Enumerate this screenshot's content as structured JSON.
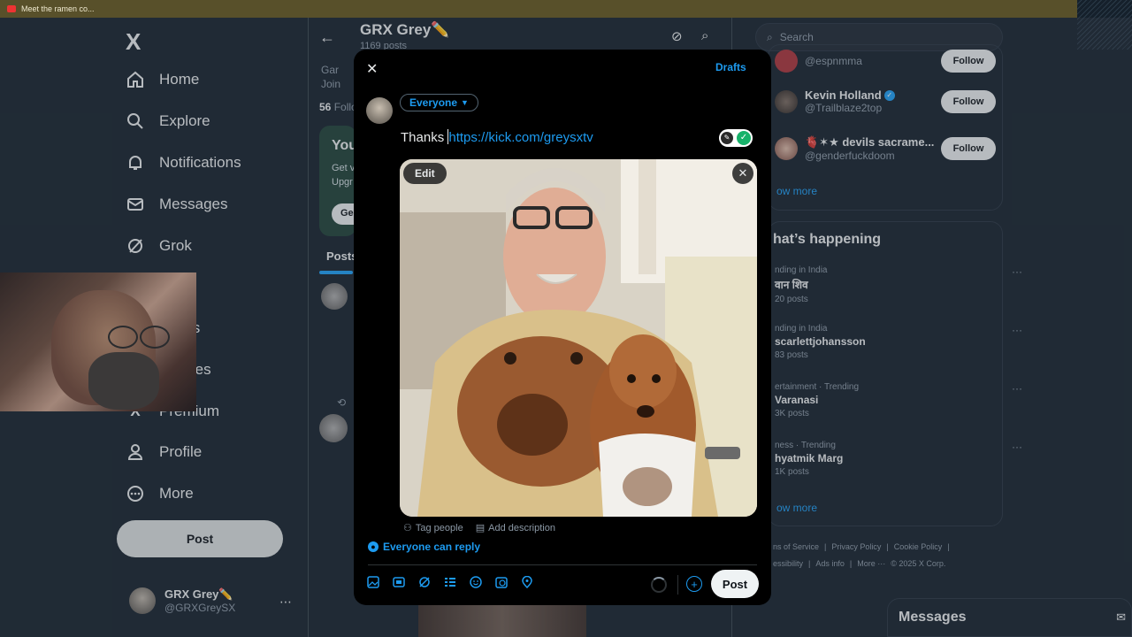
{
  "browser": {
    "tab_title": "Meet the ramen co..."
  },
  "left_nav": {
    "logo": "X",
    "items": [
      {
        "label": "Home",
        "icon": "home-icon"
      },
      {
        "label": "Explore",
        "icon": "search-icon"
      },
      {
        "label": "Notifications",
        "icon": "bell-icon"
      },
      {
        "label": "Messages",
        "icon": "envelope-icon"
      },
      {
        "label": "Grok",
        "icon": "grok-icon"
      },
      {
        "label": "marks",
        "icon": "bookmark-icon"
      },
      {
        "label": "nunities",
        "icon": "communities-icon"
      },
      {
        "label": "Premium",
        "icon": "x-icon"
      },
      {
        "label": "Profile",
        "icon": "person-icon"
      },
      {
        "label": "More",
        "icon": "more-circle-icon"
      }
    ],
    "post_label": "Post",
    "account": {
      "name": "GRX Grey✏️",
      "handle": "@GRXGreySX",
      "more": "⋯"
    }
  },
  "profile": {
    "title": "GRX Grey✏️",
    "subtitle": "1169 posts",
    "peek_line1": "Gar",
    "peek_line2": "Join",
    "peek_follow_count": "56",
    "peek_follow": "Follo",
    "peek_card_title": "You",
    "peek_card_line1": "Get v",
    "peek_card_line2": "Upgr",
    "peek_card_btn": "Ge",
    "tab_posts": "Posts"
  },
  "search": {
    "placeholder": "Search"
  },
  "who_to_follow": [
    {
      "name": "",
      "handle": "@espnmma",
      "follow": "Follow"
    },
    {
      "name": "Kevin Holland",
      "handle": "@Trailblaze2top",
      "follow": "Follow",
      "verified": true
    },
    {
      "name": "🫀✶★ devils sacrame...",
      "handle": "@genderfuckdoom",
      "follow": "Follow"
    }
  ],
  "show_more": "ow more",
  "happening_title": "hat’s happening",
  "trends": [
    {
      "context": "nding in India",
      "title": "वान शिव",
      "count": "20 posts"
    },
    {
      "context": "nding in India",
      "title": "scarlettjohansson",
      "count": "83 posts"
    },
    {
      "context": "ertainment · Trending",
      "title": "Varanasi",
      "count": "3K posts"
    },
    {
      "context": "ness · Trending",
      "title": "hyatmik Marg",
      "count": "1K posts"
    }
  ],
  "show_more_2": "ow more",
  "footer": {
    "row1": [
      "ns of Service",
      "|",
      "Privacy Policy",
      "|",
      "Cookie Policy",
      "|"
    ],
    "row2": [
      "essibility",
      "|",
      "Ads info",
      "|",
      "More ···",
      "© 2025 X Corp."
    ]
  },
  "messages_bar": {
    "label": "Messages"
  },
  "composer": {
    "close": "✕",
    "drafts": "Drafts",
    "audience": "Everyone",
    "text_plain": "Thanks ",
    "text_link": "https://kick.com/greysxtv",
    "edit": "Edit",
    "tag_people": "Tag people",
    "add_description": "Add description",
    "reply_setting": "Everyone can reply",
    "post": "Post",
    "tools": [
      "image-icon",
      "gif-icon",
      "grok-icon",
      "poll-icon",
      "emoji-icon",
      "schedule-icon",
      "location-icon"
    ]
  },
  "colors": {
    "accent": "#1d9bf0",
    "background": "#15202b",
    "modal": "#000000",
    "follow_btn": "#e7e9ea"
  }
}
